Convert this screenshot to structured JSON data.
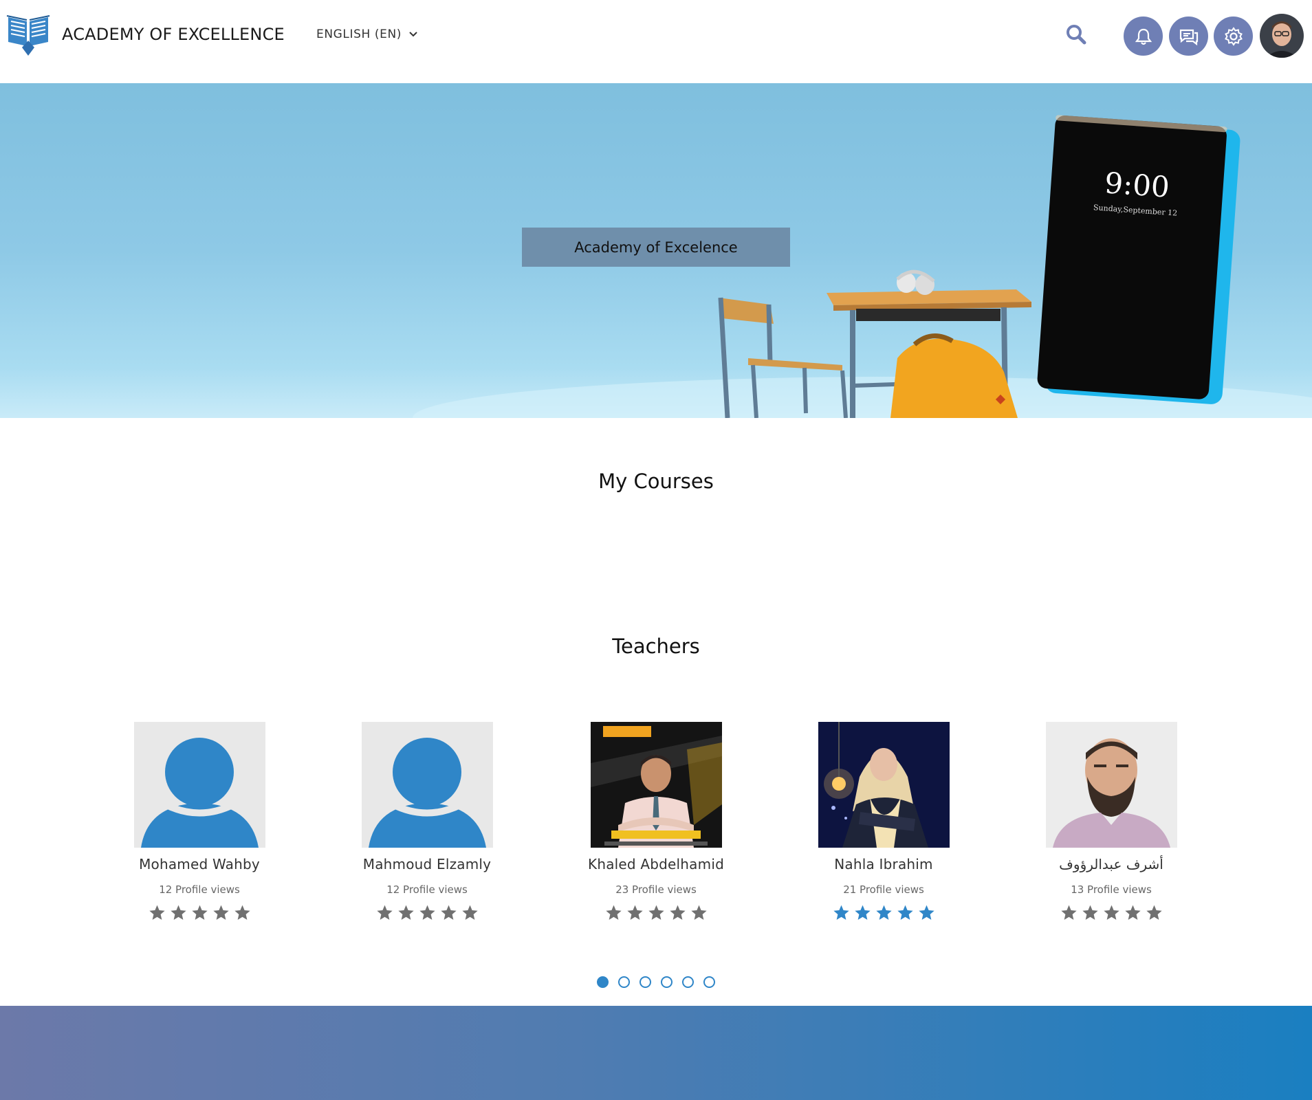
{
  "brand": {
    "name": "ACADEMY OF EXCELLENCE",
    "logo_icon": "open-book-logo-icon"
  },
  "header": {
    "language_label": "ENGLISH (EN)",
    "icons": [
      "search-icon",
      "notifications-icon",
      "messages-icon",
      "settings-icon",
      "avatar"
    ],
    "accent_color": "#6f7fb5"
  },
  "hero": {
    "title": "Academy of Excelence",
    "clock_time": "9:00",
    "clock_date": "Sunday,September 12"
  },
  "sections": {
    "my_courses": "My Courses",
    "teachers": "Teachers"
  },
  "teachers": [
    {
      "name": "Mohamed Wahby",
      "views": "12 Profile views",
      "photo": "default-avatar",
      "rating": 0
    },
    {
      "name": "Mahmoud Elzamly",
      "views": "12 Profile views",
      "photo": "default-avatar",
      "rating": 0
    },
    {
      "name": "Khaled Abdelhamid",
      "views": "23 Profile views",
      "photo": "photo",
      "rating": 0
    },
    {
      "name": "Nahla Ibrahim",
      "views": "21 Profile views",
      "photo": "photo",
      "rating": 5
    },
    {
      "name": "أشرف عبدالرؤوف",
      "views": "13 Profile views",
      "photo": "photo",
      "rating": 0
    }
  ],
  "carousel": {
    "pages": 6,
    "active": 1
  },
  "colors": {
    "star_active": "#2f86c8",
    "star_inactive": "#707070",
    "footer_start": "#6c79a9",
    "footer_end": "#1a7fc1"
  }
}
